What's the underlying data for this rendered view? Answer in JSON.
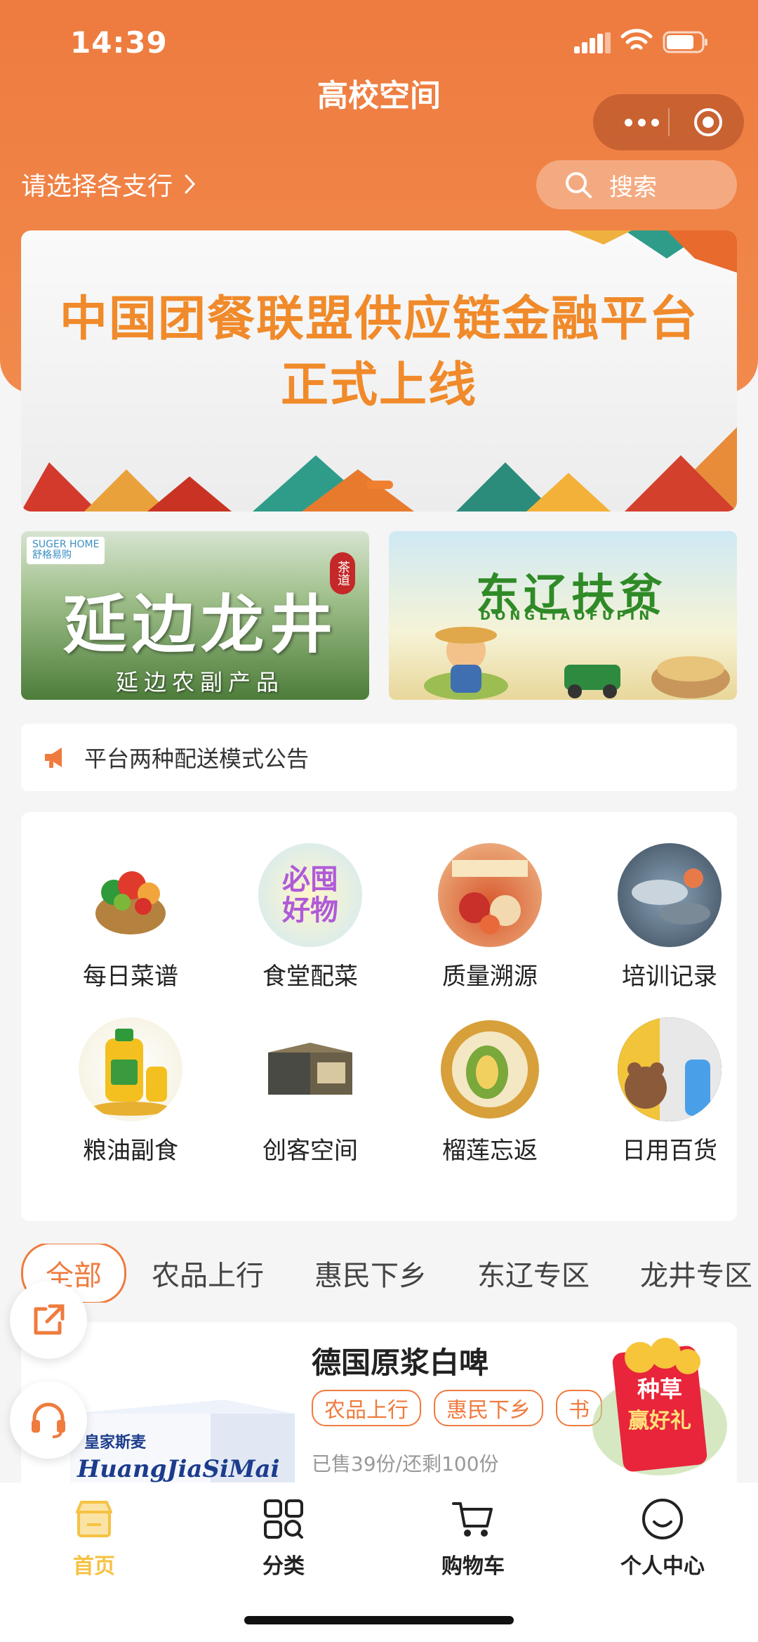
{
  "status_bar": {
    "time": "14:39"
  },
  "header": {
    "title": "高校空间",
    "branch_label": "请选择各支行",
    "search_placeholder": "搜索"
  },
  "banner": {
    "line1": "中国团餐联盟供应链金融平台",
    "line2": "正式上线"
  },
  "promos": {
    "left": {
      "brand_line1": "SUGER HOME",
      "brand_line2": "舒格易购",
      "title": "延边龙井",
      "subtitle": "延边农副产品",
      "tag": "茶道"
    },
    "right": {
      "title": "东辽扶贫",
      "subtitle": "DONGLIAOFUPIN"
    }
  },
  "notice": {
    "text": "平台两种配送模式公告"
  },
  "categories": [
    {
      "label": "每日菜谱"
    },
    {
      "label": "食堂配菜",
      "badge": "必囤好物"
    },
    {
      "label": "质量溯源"
    },
    {
      "label": "培训记录"
    },
    {
      "label": "粮油副食"
    },
    {
      "label": "创客空间"
    },
    {
      "label": "榴莲忘返"
    },
    {
      "label": "日用百货"
    }
  ],
  "tabs": [
    "全部",
    "农品上行",
    "惠民下乡",
    "东辽专区",
    "龙井专区"
  ],
  "product": {
    "name": "德国原浆白啤",
    "chips": [
      "农品上行",
      "惠民下乡",
      "书"
    ],
    "sold": "已售39份/还剩100份",
    "box_brand": "皇家斯麦",
    "box_script": "HuangJiaSiMai"
  },
  "hongbao": {
    "line1": "种草",
    "line2": "赢好礼"
  },
  "tabbar": [
    {
      "label": "首页",
      "icon": "shop-icon",
      "active": true
    },
    {
      "label": "分类",
      "icon": "category-icon",
      "active": false
    },
    {
      "label": "购物车",
      "icon": "cart-icon",
      "active": false
    },
    {
      "label": "个人中心",
      "icon": "smile-icon",
      "active": false
    }
  ],
  "colors": {
    "primary": "#ef7b3e",
    "tab_active": "#f5c243"
  }
}
